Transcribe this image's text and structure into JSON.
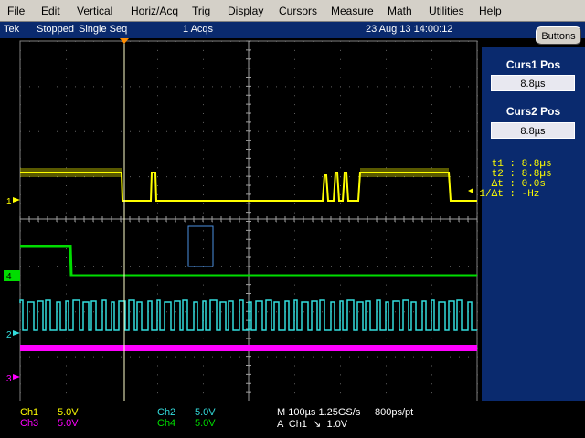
{
  "menu": [
    "File",
    "Edit",
    "Vertical",
    "Horiz/Acq",
    "Trig",
    "Display",
    "Cursors",
    "Measure",
    "Math",
    "Utilities",
    "Help"
  ],
  "status": {
    "brand": "Tek",
    "state": "Stopped",
    "mode": "Single Seq",
    "acqs": "1 Acqs",
    "datetime": "23 Aug 13 14:00:12"
  },
  "buttons_label": "Buttons",
  "cursors": {
    "curs1_label": "Curs1 Pos",
    "curs1_value": "8.8µs",
    "curs2_label": "Curs2 Pos",
    "curs2_value": "8.8µs"
  },
  "readouts": [
    {
      "label": "t1 :",
      "value": "8.8µs"
    },
    {
      "label": "t2 :",
      "value": "8.8µs"
    },
    {
      "label": "Δt :",
      "value": "0.0s"
    },
    {
      "label": "1/Δt :",
      "value": "-Hz"
    }
  ],
  "channel_markers": [
    {
      "name": "1",
      "color": "#ffff00"
    },
    {
      "name": "4",
      "color": "#00dd00"
    },
    {
      "name": "2",
      "color": "#33dddd"
    },
    {
      "name": "3",
      "color": "#ff00ff"
    }
  ],
  "channels": [
    {
      "name": "Ch1",
      "scale": "5.0V",
      "color": "#ffff00"
    },
    {
      "name": "Ch3",
      "scale": "5.0V",
      "color": "#ff00ff"
    },
    {
      "name": "Ch2",
      "scale": "5.0V",
      "color": "#33dddd"
    },
    {
      "name": "Ch4",
      "scale": "5.0V",
      "color": "#00dd00"
    }
  ],
  "horizontal": {
    "timebase": "M 100µs 1.25GS/s",
    "resolution": "800ps/pt",
    "trigger": "A  Ch1  ↘  1.0V"
  },
  "colors": {
    "ch1": "#ffff00",
    "ch2": "#33dddd",
    "ch3": "#ff00ff",
    "ch4": "#00dd00",
    "cursor": "#ffffcc",
    "grid": "#808080",
    "panel": "#0a2a6e"
  }
}
